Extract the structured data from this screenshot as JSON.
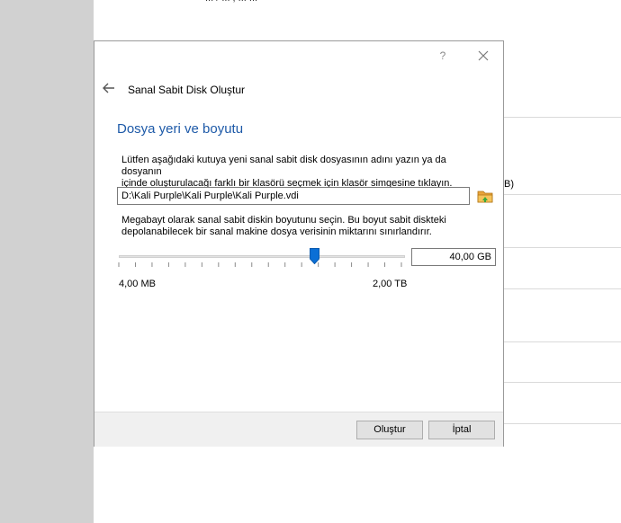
{
  "background": {
    "top_text": "... / ... , ... ...",
    "size_suffix": "B)"
  },
  "dialog": {
    "help_label": "?",
    "title": "Sanal Sabit Disk Oluştur",
    "section_title": "Dosya yeri ve boyutu",
    "location_description_line1": "Lütfen aşağıdaki kutuya yeni sanal sabit disk dosyasının adını yazın ya da dosyanın",
    "location_description_line2": "içinde oluşturulacağı farklı bir klasörü seçmek için klasör simgesine tıklayın.",
    "file_path": "D:\\Kali Purple\\Kali Purple\\Kali Purple.vdi",
    "size_description_line1": "Megabayt olarak sanal sabit diskin boyutunu seçin. Bu boyut sabit diskteki",
    "size_description_line2": "depolanabilecek bir sanal makine dosya verisinin miktarını sınırlandırır.",
    "slider": {
      "min_label": "4,00 MB",
      "max_label": "2,00 TB",
      "value_fraction": 0.69
    },
    "size_value": "40,00 GB",
    "buttons": {
      "create": "Oluştur",
      "cancel": "İptal"
    },
    "icons": {
      "back": "back-arrow-icon",
      "close": "close-icon",
      "folder": "folder-icon"
    },
    "colors": {
      "accent": "#1e5aa8",
      "slider_thumb": "#0b6fd6",
      "folder": "#e8a33a"
    }
  }
}
